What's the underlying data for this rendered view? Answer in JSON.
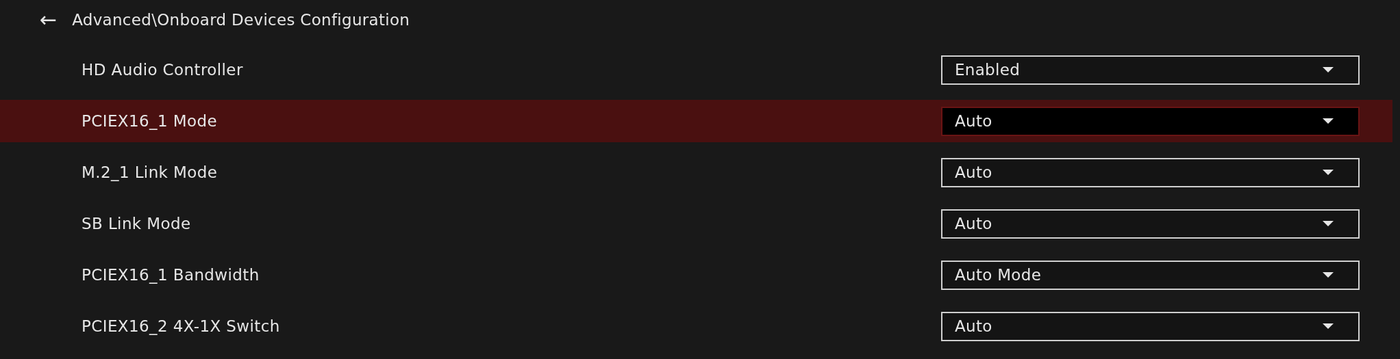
{
  "header": {
    "back": "←",
    "path": "Advanced\\Onboard Devices Configuration"
  },
  "settings": [
    {
      "label": "HD Audio Controller",
      "value": "Enabled",
      "selected": false
    },
    {
      "label": "PCIEX16_1 Mode",
      "value": "Auto",
      "selected": true
    },
    {
      "label": "M.2_1 Link Mode",
      "value": "Auto",
      "selected": false
    },
    {
      "label": "SB Link Mode",
      "value": "Auto",
      "selected": false
    },
    {
      "label": "PCIEX16_1 Bandwidth",
      "value": "Auto Mode",
      "selected": false
    },
    {
      "label": "PCIEX16_2 4X-1X Switch",
      "value": "Auto",
      "selected": false
    }
  ]
}
